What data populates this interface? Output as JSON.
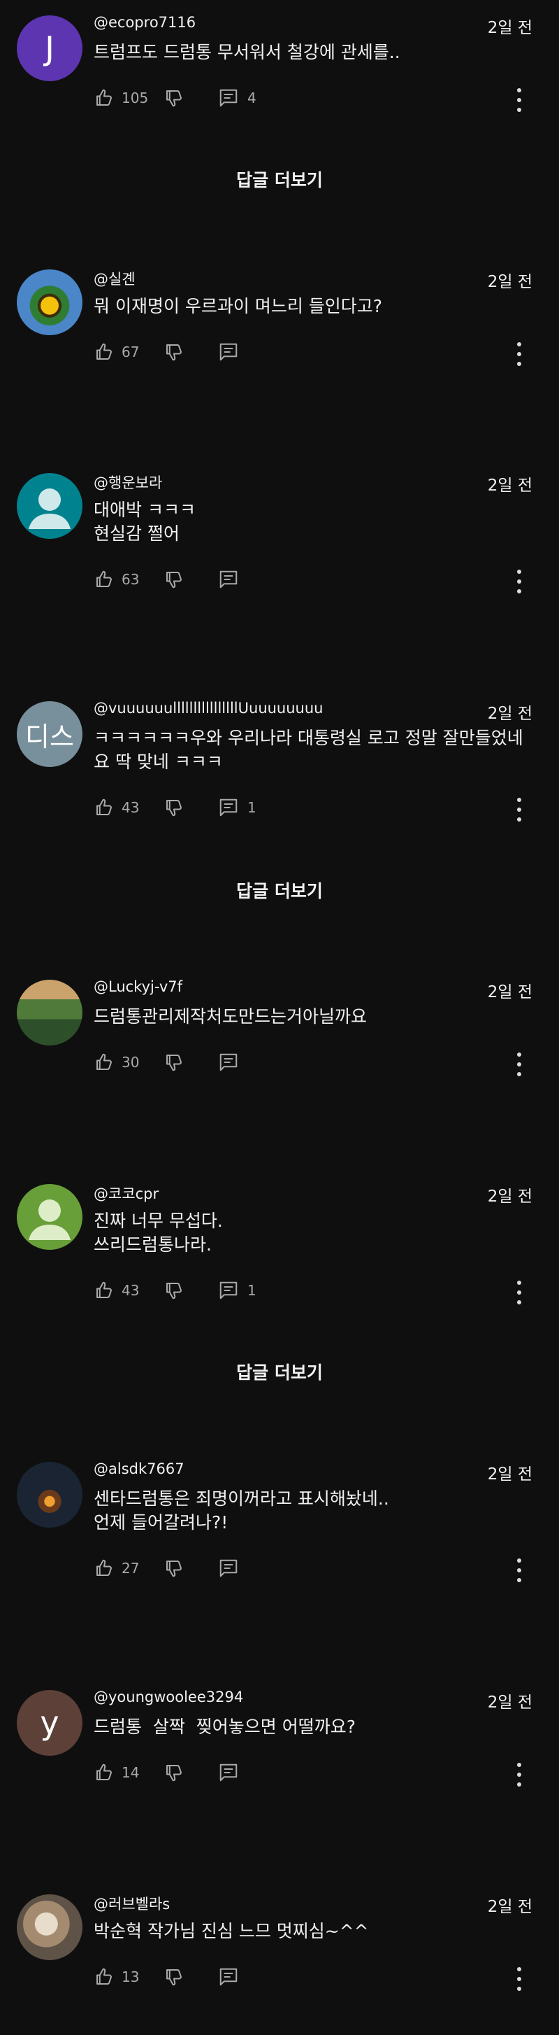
{
  "more_replies_label": "답글 더보기",
  "comments": [
    {
      "author": "@ecopro7116",
      "time": "2일 전",
      "text": "트럼프도 드럼통 무서워서 철강에 관세를..",
      "likes": "105",
      "replies": "4",
      "avatar_letter": "J",
      "avatar_color": "#5e35b1",
      "avatar_icon": "letter-avatar"
    },
    {
      "author": "@실곈",
      "time": "2일 전",
      "text": "뭐 이재명이 우르과이 며느리 들인다고?",
      "likes": "67",
      "replies": "",
      "avatar_letter": "",
      "avatar_color": "#3a6bb5",
      "avatar_icon": "sunflower-photo"
    },
    {
      "author": "@행운보라",
      "time": "2일 전",
      "text": "대애박 ㅋㅋㅋ\n현실감 쩔어",
      "likes": "63",
      "replies": "",
      "avatar_letter": "",
      "avatar_color": "#00838f",
      "avatar_icon": "default-person"
    },
    {
      "author": "@vuuuuuullllllllllllllllUuuuuuuuu",
      "time": "2일 전",
      "text": "ㅋㅋㅋㅋㅋㅋ우와 우리나라 대통령실 로고 정말 잘만들었네요 딱 맞네 ㅋㅋㅋ",
      "likes": "43",
      "replies": "1",
      "avatar_letter": "디스",
      "avatar_color": "#78909c",
      "avatar_icon": "letter-avatar"
    },
    {
      "author": "@Luckyj-v7f",
      "time": "2일 전",
      "text": "드럼통관리제작처도만드는거아닐까요",
      "likes": "30",
      "replies": "",
      "avatar_letter": "",
      "avatar_color": "#6d5a3a",
      "avatar_icon": "landscape-photo"
    },
    {
      "author": "@코코cpr",
      "time": "2일 전",
      "text": "진짜 너무 무섭다.\n쓰리드럼통나라.",
      "likes": "43",
      "replies": "1",
      "avatar_letter": "",
      "avatar_color": "#689f38",
      "avatar_icon": "default-person"
    },
    {
      "author": "@alsdk7667",
      "time": "2일 전",
      "text": "센타드럼통은 죄명이꺼라고 표시해놨네..\n언제 들어갈려나?!",
      "likes": "27",
      "replies": "",
      "avatar_letter": "",
      "avatar_color": "#1a2433",
      "avatar_icon": "night-city-photo"
    },
    {
      "author": "@youngwoolee3294",
      "time": "2일 전",
      "text": "드럼통  살짝  찢어놓으면 어떨까요?",
      "likes": "14",
      "replies": "",
      "avatar_letter": "y",
      "avatar_color": "#5d4037",
      "avatar_icon": "letter-avatar"
    },
    {
      "author": "@러브벨라s",
      "time": "2일 전",
      "text": "박순혁 작가님 진심 느므 멋찌심~^^",
      "likes": "13",
      "replies": "",
      "avatar_letter": "",
      "avatar_color": "#8d7b6a",
      "avatar_icon": "pet-photo"
    }
  ]
}
